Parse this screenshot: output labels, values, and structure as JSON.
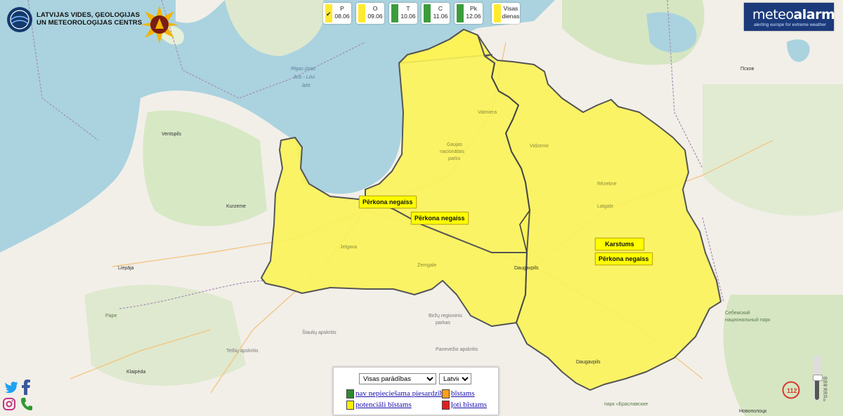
{
  "header": {
    "org_line1": "LATVIJAS VIDES, ĢEOLOĢIJAS",
    "org_line2": "UN METEOROLOĢIJAS CENTRS"
  },
  "days": [
    {
      "day": "P",
      "date": "08.06",
      "color": "#ffea2f",
      "selected": true
    },
    {
      "day": "O",
      "date": "09.06",
      "color": "#ffea2f",
      "selected": false
    },
    {
      "day": "T",
      "date": "10.06",
      "color": "#3c9c3c",
      "selected": false
    },
    {
      "day": "C",
      "date": "11.06",
      "color": "#3c9c3c",
      "selected": false
    },
    {
      "day": "Pk",
      "date": "12.06",
      "color": "#3c9c3c",
      "selected": false
    },
    {
      "day": "Visas",
      "date": "dienas",
      "color": "#ffea2f",
      "selected": false
    }
  ],
  "meteoalarm": {
    "title_a": "meteo",
    "title_b": "alarm",
    "subtitle": "alerting europe for extreme weather"
  },
  "warnings": [
    "Pērkona negaiss",
    "Pērkona negaiss",
    "Karstums",
    "Pērkona negaiss"
  ],
  "map_labels": {
    "gulf": "Rīgas jūras līcis - Liivi laht",
    "ventspils": "Ventspils",
    "kurzeme": "Kurzeme",
    "liepaja": "Liepāja",
    "jelgava": "Jelgava",
    "zemgale": "Zemgale",
    "valmiera": "Valmiera",
    "vidzeme": "Vidzeme",
    "gauja": "Gaujas nacionālais parks",
    "latgale": "Latgale",
    "daugavpils": "Daugavpils",
    "pskov": "Псков",
    "rezekne": "Rēzekne",
    "klaipeda": "Klaipėda",
    "siauliai": "Šiaulių apskritis",
    "panevezys": "Panevėžio apskritis",
    "telsiai": "Telšių apskritis",
    "birzu": "Biržų regioninis parkas",
    "novopolotsk": "Новополоцк",
    "sebezh": "Себежский национальный парк",
    "brasl": "Национальный парк «Браславские озера»",
    "pape": "Pape"
  },
  "legend": {
    "select_display": "Visas parādības",
    "select_language": "Latviešu",
    "items": [
      {
        "label": "nav nepieciešama piesardzība",
        "color": "#2e8b2e"
      },
      {
        "label": "bīstams",
        "color": "#ff9f1c"
      },
      {
        "label": "potenciāli bīstams",
        "color": "#ffee00"
      },
      {
        "label": "ļoti bīstams",
        "color": "#e02020"
      }
    ]
  },
  "colors": {
    "warning_yellow": "#ffff33",
    "sea": "#aad3df",
    "land": "#f2efe9"
  },
  "icons": [
    "twitter-icon",
    "facebook-icon",
    "instagram-icon",
    "phone-icon",
    "emergency-112-icon"
  ],
  "emergency_number": "112",
  "zoom_ticks": [
    "60",
    "50",
    "40",
    "30",
    "20",
    "10",
    "0"
  ]
}
